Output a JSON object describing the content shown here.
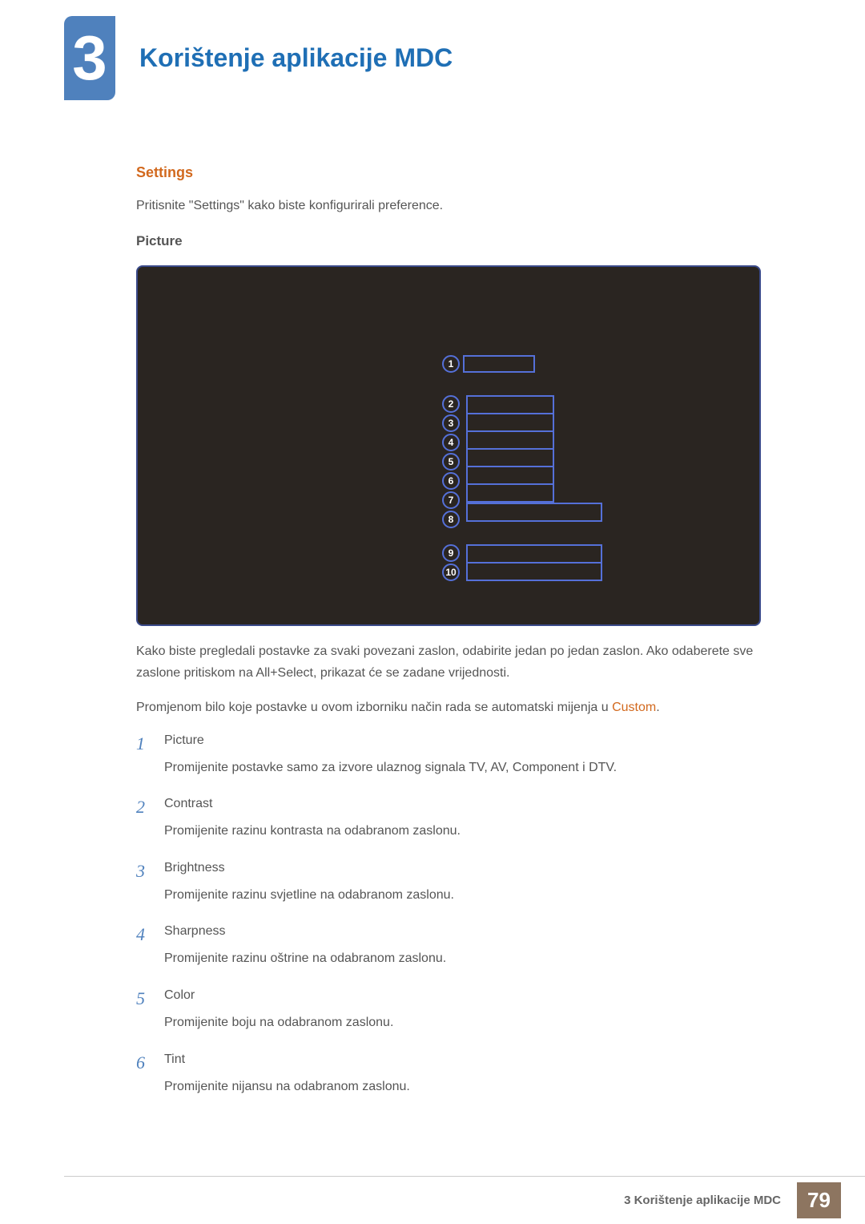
{
  "chapter": {
    "number": "3",
    "title": "Korištenje aplikacije MDC"
  },
  "settings": {
    "heading": "Settings",
    "intro": "Pritisnite \"Settings\" kako biste konfigurirali preference.",
    "picture_label": "Picture"
  },
  "diagram_markers": [
    "1",
    "2",
    "3",
    "4",
    "5",
    "6",
    "7",
    "8",
    "9",
    "10"
  ],
  "paragraphs": {
    "p1": "Kako biste pregledali postavke za svaki povezani zaslon, odabirite jedan po jedan zaslon. Ako odaberete sve zaslone pritiskom na All+Select, prikazat će se zadane vrijednosti.",
    "p2_pre": "Promjenom bilo koje postavke u ovom izborniku način rada se automatski mijenja u ",
    "p2_highlight": "Custom",
    "p2_post": "."
  },
  "list": [
    {
      "num": "1",
      "title": "Picture",
      "desc": "Promijenite postavke samo za izvore ulaznog signala TV, AV, Component i DTV."
    },
    {
      "num": "2",
      "title": "Contrast",
      "desc": "Promijenite razinu kontrasta na odabranom zaslonu."
    },
    {
      "num": "3",
      "title": "Brightness",
      "desc": "Promijenite razinu svjetline na odabranom zaslonu."
    },
    {
      "num": "4",
      "title": "Sharpness",
      "desc": "Promijenite razinu oštrine na odabranom zaslonu."
    },
    {
      "num": "5",
      "title": "Color",
      "desc": "Promijenite boju na odabranom zaslonu."
    },
    {
      "num": "6",
      "title": "Tint",
      "desc": "Promijenite nijansu na odabranom zaslonu."
    }
  ],
  "footer": {
    "text": "3 Korištenje aplikacije MDC",
    "page": "79"
  }
}
